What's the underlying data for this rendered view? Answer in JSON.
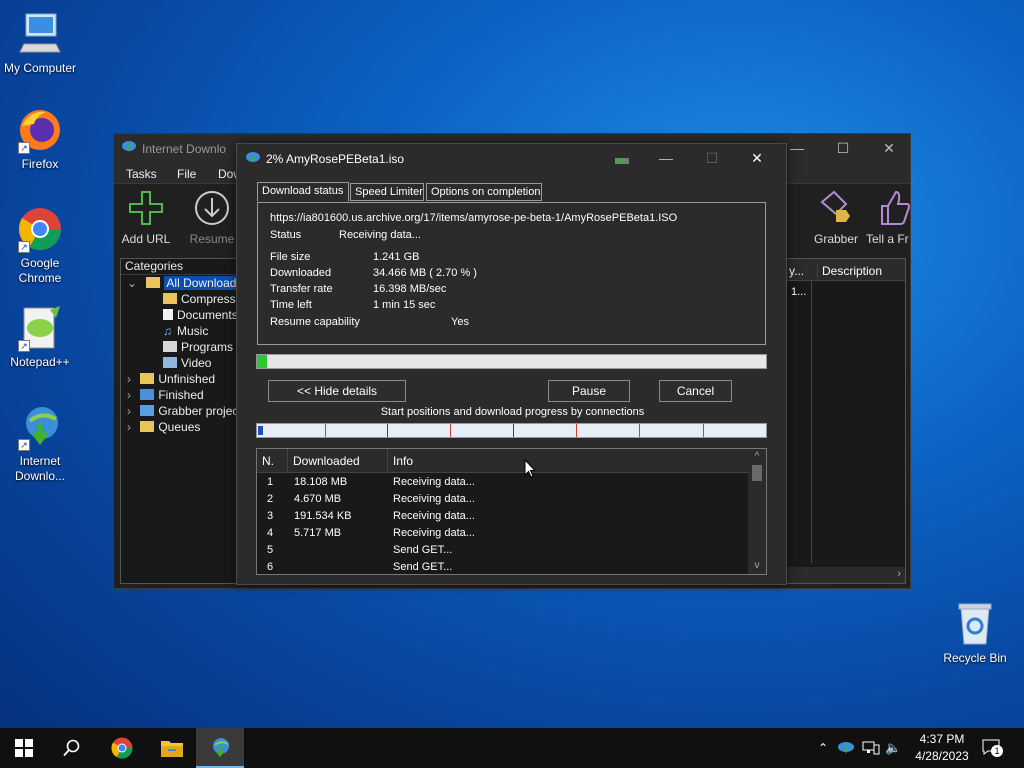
{
  "desktop": {
    "icons": [
      {
        "label": "My Computer"
      },
      {
        "label": "Firefox"
      },
      {
        "label": "Google Chrome"
      },
      {
        "label": "Notepad++"
      },
      {
        "label": "Internet Downlo..."
      },
      {
        "label": "Recycle Bin"
      }
    ]
  },
  "idm_main": {
    "title": "Internet Downlo",
    "menu": [
      "Tasks",
      "File",
      "Dow"
    ],
    "toolbar": {
      "add_url": "Add URL",
      "resume": "Resume",
      "grabber": "Grabber",
      "tell_friend": "Tell a Fr"
    },
    "categories_header": "Categories",
    "tree": [
      "All Downloads",
      "Compresse",
      "Documents",
      "Music",
      "Programs",
      "Video",
      "Unfinished",
      "Finished",
      "Grabber projec",
      "Queues"
    ],
    "list_header": {
      "col_partial": "y...",
      "description": "Description"
    },
    "list_row_partial": "1..."
  },
  "dialog": {
    "title": "2% AmyRosePEBeta1.iso",
    "tabs": [
      "Download status",
      "Speed Limiter",
      "Options on completion"
    ],
    "url": "https://ia801600.us.archive.org/17/items/amyrose-pe-beta-1/AmyRosePEBeta1.ISO",
    "status_label": "Status",
    "status_value": "Receiving data...",
    "file_size_label": "File size",
    "file_size_value": "1.241  GB",
    "downloaded_label": "Downloaded",
    "downloaded_value": "34.466  MB  ( 2.70 % )",
    "transfer_rate_label": "Transfer rate",
    "transfer_rate_value": "16.398  MB/sec",
    "time_left_label": "Time left",
    "time_left_value": "1 min 15 sec",
    "resume_label": "Resume capability",
    "resume_value": "Yes",
    "progress_percent": 2,
    "buttons": {
      "hide_details": "<< Hide details",
      "pause": "Pause",
      "cancel": "Cancel"
    },
    "connections_label": "Start positions and download progress by connections",
    "connections_table": {
      "headers": [
        "N.",
        "Downloaded",
        "Info"
      ],
      "rows": [
        {
          "n": "1",
          "downloaded": "18.108  MB",
          "info": "Receiving data..."
        },
        {
          "n": "2",
          "downloaded": "4.670  MB",
          "info": "Receiving data..."
        },
        {
          "n": "3",
          "downloaded": "191.534  KB",
          "info": "Receiving data..."
        },
        {
          "n": "4",
          "downloaded": "5.717  MB",
          "info": "Receiving data..."
        },
        {
          "n": "5",
          "downloaded": "",
          "info": "Send GET..."
        },
        {
          "n": "6",
          "downloaded": "",
          "info": "Send GET..."
        }
      ]
    }
  },
  "taskbar": {
    "time": "4:37 PM",
    "date": "4/28/2023",
    "notification_count": "1"
  }
}
